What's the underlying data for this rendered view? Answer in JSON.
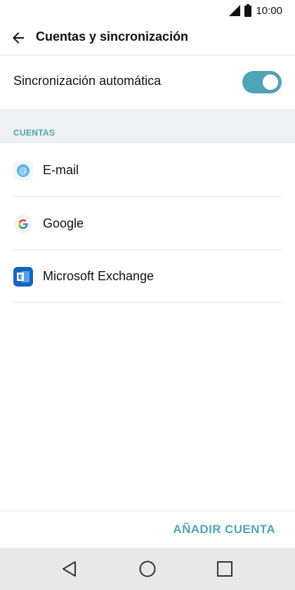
{
  "status_bar": {
    "time": "10:00",
    "icons": [
      "signal-icon",
      "battery-icon"
    ]
  },
  "header": {
    "title": "Cuentas y sincronización",
    "back_icon": "arrow-left-icon"
  },
  "sync": {
    "label": "Sincronización automática",
    "enabled": true
  },
  "accounts_section": {
    "title": "CUENTAS",
    "items": [
      {
        "label": "E-mail",
        "icon": "email-at-icon"
      },
      {
        "label": "Google",
        "icon": "google-icon"
      },
      {
        "label": "Microsoft Exchange",
        "icon": "exchange-icon"
      }
    ]
  },
  "footer": {
    "add_account_label": "AÑADIR CUENTA"
  },
  "nav_bar": {
    "buttons": [
      "back-triangle-icon",
      "home-circle-icon",
      "recents-square-icon"
    ]
  },
  "colors": {
    "accent": "#4fa5b5",
    "section_bg": "#eef0f1",
    "nav_bg": "#e8e8e8"
  }
}
